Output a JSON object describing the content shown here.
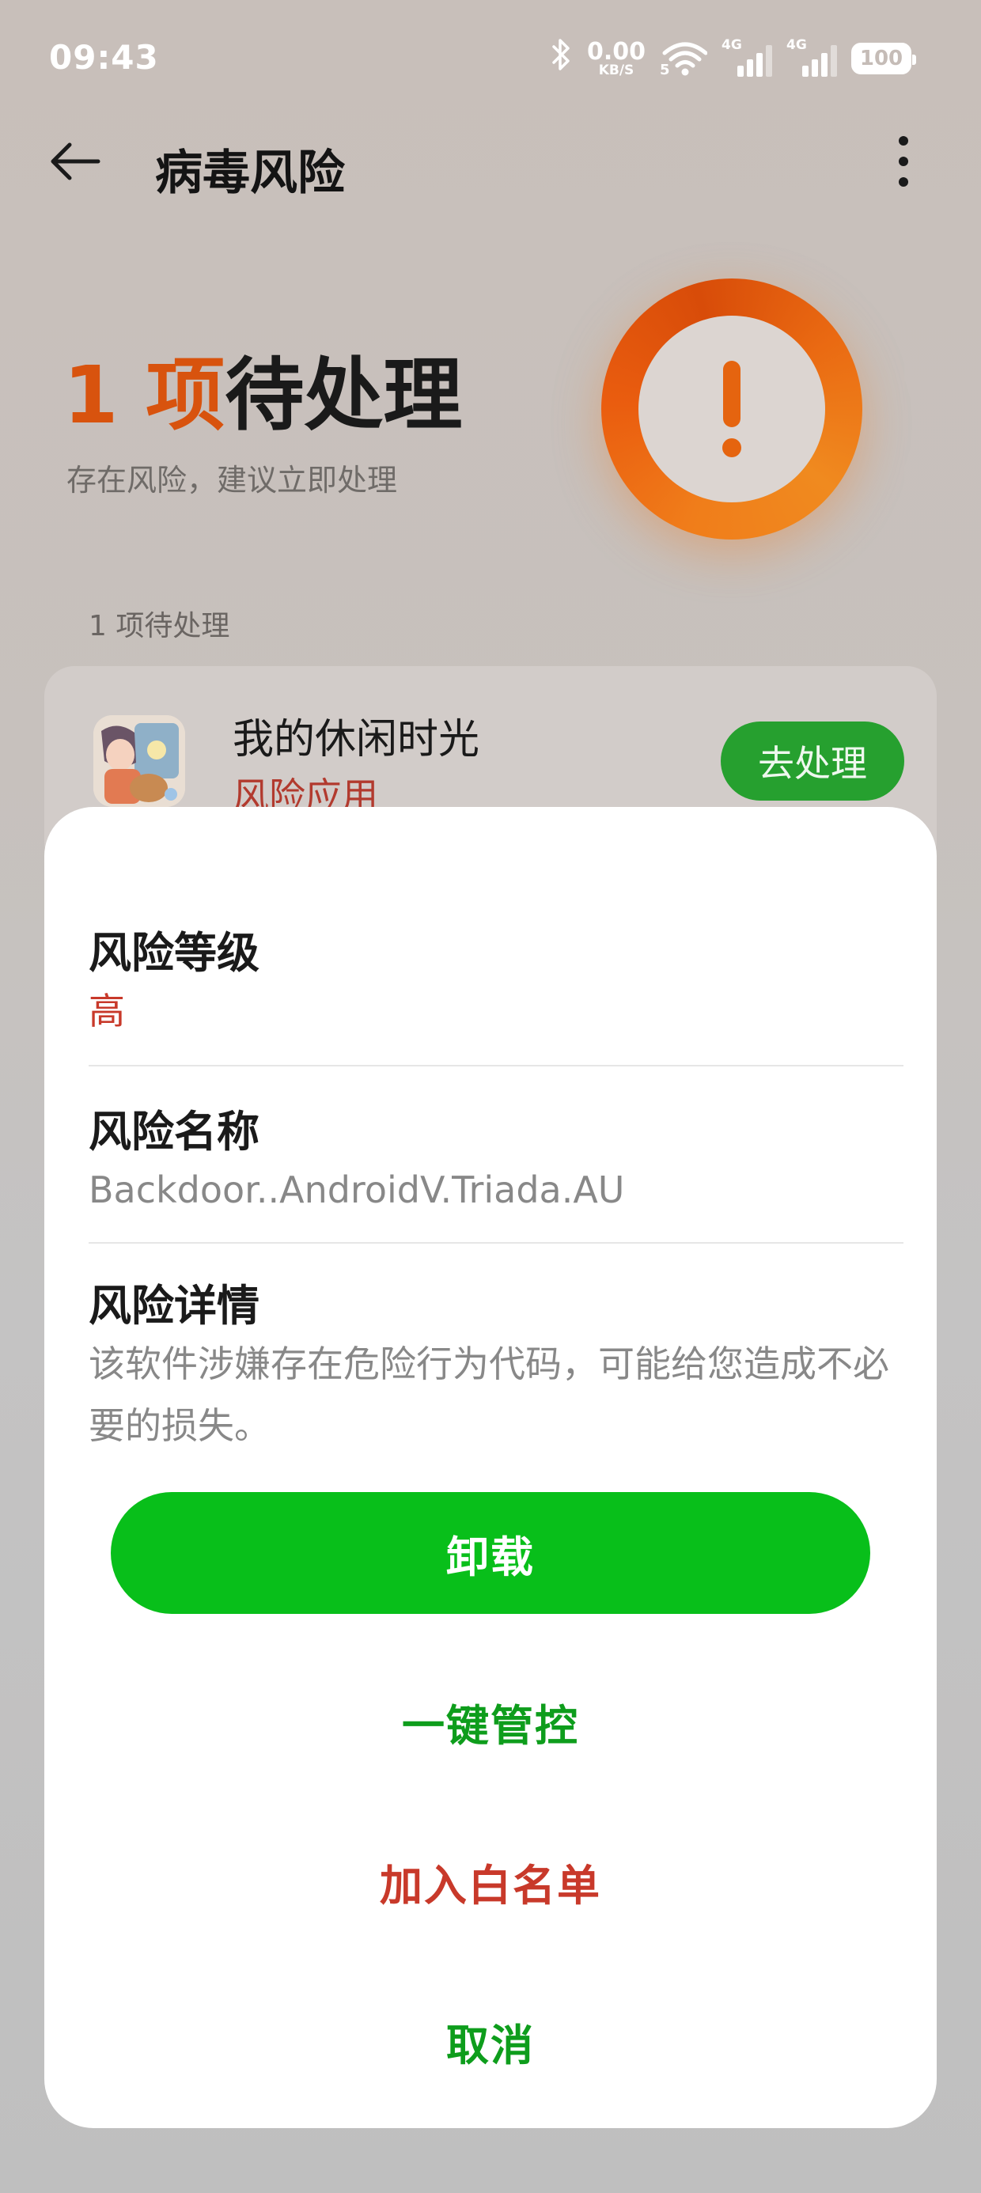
{
  "status_bar": {
    "time": "09:43",
    "net_speed": "0.00",
    "net_unit": "KB/S",
    "wifi_gen": "5",
    "sim1_gen": "4G",
    "sim2_gen": "4G",
    "battery": "100"
  },
  "header": {
    "title": "病毒风险"
  },
  "summary": {
    "count": "1 项",
    "title_suffix": "待处理",
    "subtitle": "存在风险，建议立即处理"
  },
  "pending_section": {
    "label": "1 项待处理"
  },
  "item": {
    "app_name": "我的休闲时光",
    "tag": "风险应用",
    "action": "去处理"
  },
  "sheet": {
    "risk_level_label": "风险等级",
    "risk_level_value": "高",
    "risk_name_label": "风险名称",
    "risk_name_value": "Backdoor..AndroidV.Triada.AU",
    "risk_detail_label": "风险详情",
    "risk_detail_value": "该软件涉嫌存在危险行为代码，可能给您造成不必要的损失。",
    "uninstall_label": "卸载",
    "control_label": "一键管控",
    "whitelist_label": "加入白名单",
    "cancel_label": "取消"
  },
  "colors": {
    "accent_orange": "#d8530e",
    "danger_red": "#c8392a",
    "primary_green": "#08bf1a",
    "text_green": "#0e9d1c"
  }
}
